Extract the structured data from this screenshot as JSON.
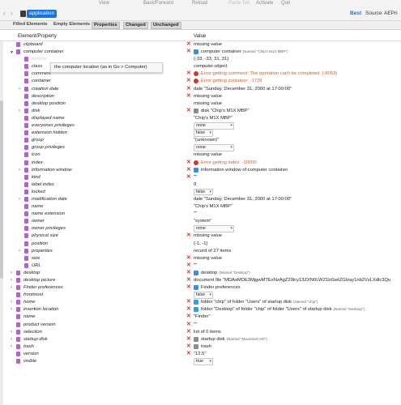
{
  "toolbar": {
    "view": "View",
    "back_forward": "Back/Forward",
    "reload": "Reload",
    "paste_tell": "Paste Tell",
    "activate": "Activate",
    "quit": "Quit"
  },
  "topbar": {
    "crumb": "application",
    "best": "Best",
    "source": "Source",
    "ae": "AEPri"
  },
  "tabs": [
    "Filled Elements",
    "Empty Elements",
    "Properties",
    "Changed",
    "Unchanged"
  ],
  "header": {
    "col1": "Element/Property",
    "col2": "Value"
  },
  "tooltip": "the computer location (as in Go > Computer)",
  "rows": [
    {
      "d": "",
      "ind": 0,
      "name": "clipboard",
      "it": true,
      "x": true,
      "val": "missing value"
    },
    {
      "d": "v",
      "ind": 0,
      "name": "computer container",
      "it": true,
      "x": true,
      "vi": "finder",
      "val": "computer container",
      "sub": "(Named \"Chip's M1X MBP\")"
    },
    {
      "d": "",
      "ind": 1,
      "name": "bounds",
      "hl": true,
      "x": false,
      "val": "{-33, -33, 31, 31}"
    },
    {
      "d": "",
      "ind": 1,
      "name": "class",
      "x": false,
      "val": "computer-object"
    },
    {
      "d": "",
      "ind": 1,
      "name": "comment",
      "x": true,
      "vi": "err",
      "val": "Error getting comment: The operation can't be completed. (-8053)",
      "err": true
    },
    {
      "d": "",
      "ind": 1,
      "name": "container",
      "x": true,
      "vi": "err",
      "val": "Error getting container: -1728",
      "err": true
    },
    {
      "d": ">",
      "ind": 1,
      "name": "creation date",
      "x": true,
      "val": "date \"Sunday, December 31, 2000 at 17:00:00\""
    },
    {
      "d": "",
      "ind": 1,
      "name": "description",
      "x": true,
      "val": "missing value"
    },
    {
      "d": "",
      "ind": 1,
      "name": "desktop position",
      "x": false,
      "val": "missing value"
    },
    {
      "d": ">",
      "ind": 1,
      "name": "disk",
      "x": true,
      "vi": "disk",
      "val": "disk \"Chip's M1X MBP\""
    },
    {
      "d": "",
      "ind": 1,
      "name": "displayed name",
      "x": false,
      "val": "\"Chip's M1X MBP\""
    },
    {
      "d": "",
      "ind": 1,
      "name": "everyones privileges",
      "x": false,
      "sel": "none"
    },
    {
      "d": "",
      "ind": 1,
      "name": "extension hidden",
      "x": false,
      "sel": "false"
    },
    {
      "d": "",
      "ind": 1,
      "name": "group",
      "x": false,
      "val": "\"(unknown)\""
    },
    {
      "d": "",
      "ind": 1,
      "name": "group privileges",
      "x": false,
      "sel": "none"
    },
    {
      "d": "",
      "ind": 1,
      "name": "icon",
      "x": false,
      "val": "missing value"
    },
    {
      "d": "",
      "ind": 1,
      "name": "index",
      "x": true,
      "vi": "err",
      "val": "Error getting index: -10000",
      "err": true
    },
    {
      "d": ">",
      "ind": 1,
      "name": "information window",
      "x": true,
      "vi": "finder",
      "val": "information window of computer container"
    },
    {
      "d": "",
      "ind": 1,
      "name": "kind",
      "x": true,
      "val": "\"\""
    },
    {
      "d": "",
      "ind": 1,
      "name": "label index",
      "x": false,
      "val": "0"
    },
    {
      "d": "",
      "ind": 1,
      "name": "locked",
      "x": false,
      "sel": "false"
    },
    {
      "d": ">",
      "ind": 1,
      "name": "modification date",
      "x": false,
      "val": "date \"Sunday, December 31, 2000 at 17:00:00\""
    },
    {
      "d": "",
      "ind": 1,
      "name": "name",
      "x": false,
      "val": "\"Chip's M1X MBP\""
    },
    {
      "d": "",
      "ind": 1,
      "name": "name extension",
      "x": false,
      "val": "\"\""
    },
    {
      "d": "",
      "ind": 1,
      "name": "owner",
      "x": false,
      "val": "\"system\""
    },
    {
      "d": "",
      "ind": 1,
      "name": "owner privileges",
      "x": false,
      "sel": "none"
    },
    {
      "d": "",
      "ind": 1,
      "name": "physical size",
      "x": true,
      "val": "missing value"
    },
    {
      "d": "",
      "ind": 1,
      "name": "position",
      "x": false,
      "val": "{-1, -1}"
    },
    {
      "d": ">",
      "ind": 1,
      "name": "properties",
      "x": false,
      "val": "record of 27 items"
    },
    {
      "d": "",
      "ind": 1,
      "name": "size",
      "x": true,
      "val": "missing value"
    },
    {
      "d": "",
      "ind": 1,
      "name": "URL",
      "x": true,
      "val": "\"\""
    },
    {
      "d": ">",
      "ind": 0,
      "name": "desktop",
      "x": true,
      "vi": "finder",
      "val": "desktop",
      "sub": "(Named \"Desktop\")"
    },
    {
      "d": ">",
      "ind": 0,
      "name": "desktop picture",
      "x": true,
      "val": "document file \"MDAxMDE3MjgwMTExNzAgZ29lcy13ZXN0LWZ1bGwtZGlzay1nb2VzLXdlc3Qu"
    },
    {
      "d": ">",
      "ind": 0,
      "name": "Finder preferences",
      "x": true,
      "vi": "finder",
      "val": "Finder preferences"
    },
    {
      "d": "",
      "ind": 0,
      "name": "frontmost",
      "x": false,
      "sel": "false"
    },
    {
      "d": ">",
      "ind": 0,
      "name": "home",
      "x": true,
      "vi": "folder",
      "val": "folder \"chip\" of folder \"Users\" of startup disk",
      "sub": "(Named \"chip\")"
    },
    {
      "d": ">",
      "ind": 0,
      "name": "insertion location",
      "x": true,
      "vi": "folder",
      "val": "folder \"Desktop\" of folder \"chip\" of folder \"Users\" of startup disk",
      "sub": "(Named \"Desktop\")"
    },
    {
      "d": "",
      "ind": 0,
      "name": "name",
      "x": true,
      "val": "\"Finder\""
    },
    {
      "d": "",
      "ind": 0,
      "name": "product version",
      "x": true,
      "val": "\"\""
    },
    {
      "d": ">",
      "ind": 0,
      "name": "selection",
      "x": true,
      "val": "list of 0 items"
    },
    {
      "d": ">",
      "ind": 0,
      "name": "startup disk",
      "x": true,
      "vi": "disk",
      "val": "startup disk",
      "sub": "(Named \"Macintosh HD\")"
    },
    {
      "d": ">",
      "ind": 0,
      "name": "trash",
      "x": true,
      "vi": "disk",
      "val": "trash"
    },
    {
      "d": "",
      "ind": 0,
      "name": "version",
      "x": true,
      "val": "\"12.5\""
    },
    {
      "d": "",
      "ind": 0,
      "name": "visible",
      "x": false,
      "sel": "true"
    }
  ]
}
